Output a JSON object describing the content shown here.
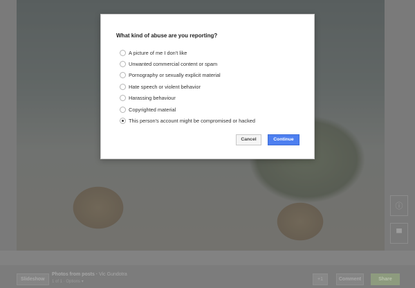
{
  "dialog": {
    "title": "What kind of abuse are you reporting?",
    "options": [
      {
        "label": "A picture of me I don't like",
        "checked": false
      },
      {
        "label": "Unwanted commercial content or spam",
        "checked": false
      },
      {
        "label": "Pornography or sexually explicit material",
        "checked": false
      },
      {
        "label": "Hate speech or violent behavior",
        "checked": false
      },
      {
        "label": "Harassing behaviour",
        "checked": false
      },
      {
        "label": "Copyrighted material",
        "checked": false
      },
      {
        "label": "This person's account might be compromised or hacked",
        "checked": true
      }
    ],
    "cancel_label": "Cancel",
    "continue_label": "Continue"
  },
  "bottom_bar": {
    "slideshow_label": "Slideshow",
    "album_title": "Photos from posts",
    "album_author": "Vic Gundotra",
    "album_position": "1 of 1",
    "album_options": "Options",
    "plus_label": "+1",
    "comment_label": "Comment",
    "share_label": "Share"
  },
  "right_controls": [
    {
      "icon": "info-icon",
      "glyph": "ⓘ"
    },
    {
      "icon": "comment-icon",
      "glyph": "▀"
    }
  ],
  "colors": {
    "accent": "#4d7ff0",
    "overlay": "#7c7c7c"
  }
}
